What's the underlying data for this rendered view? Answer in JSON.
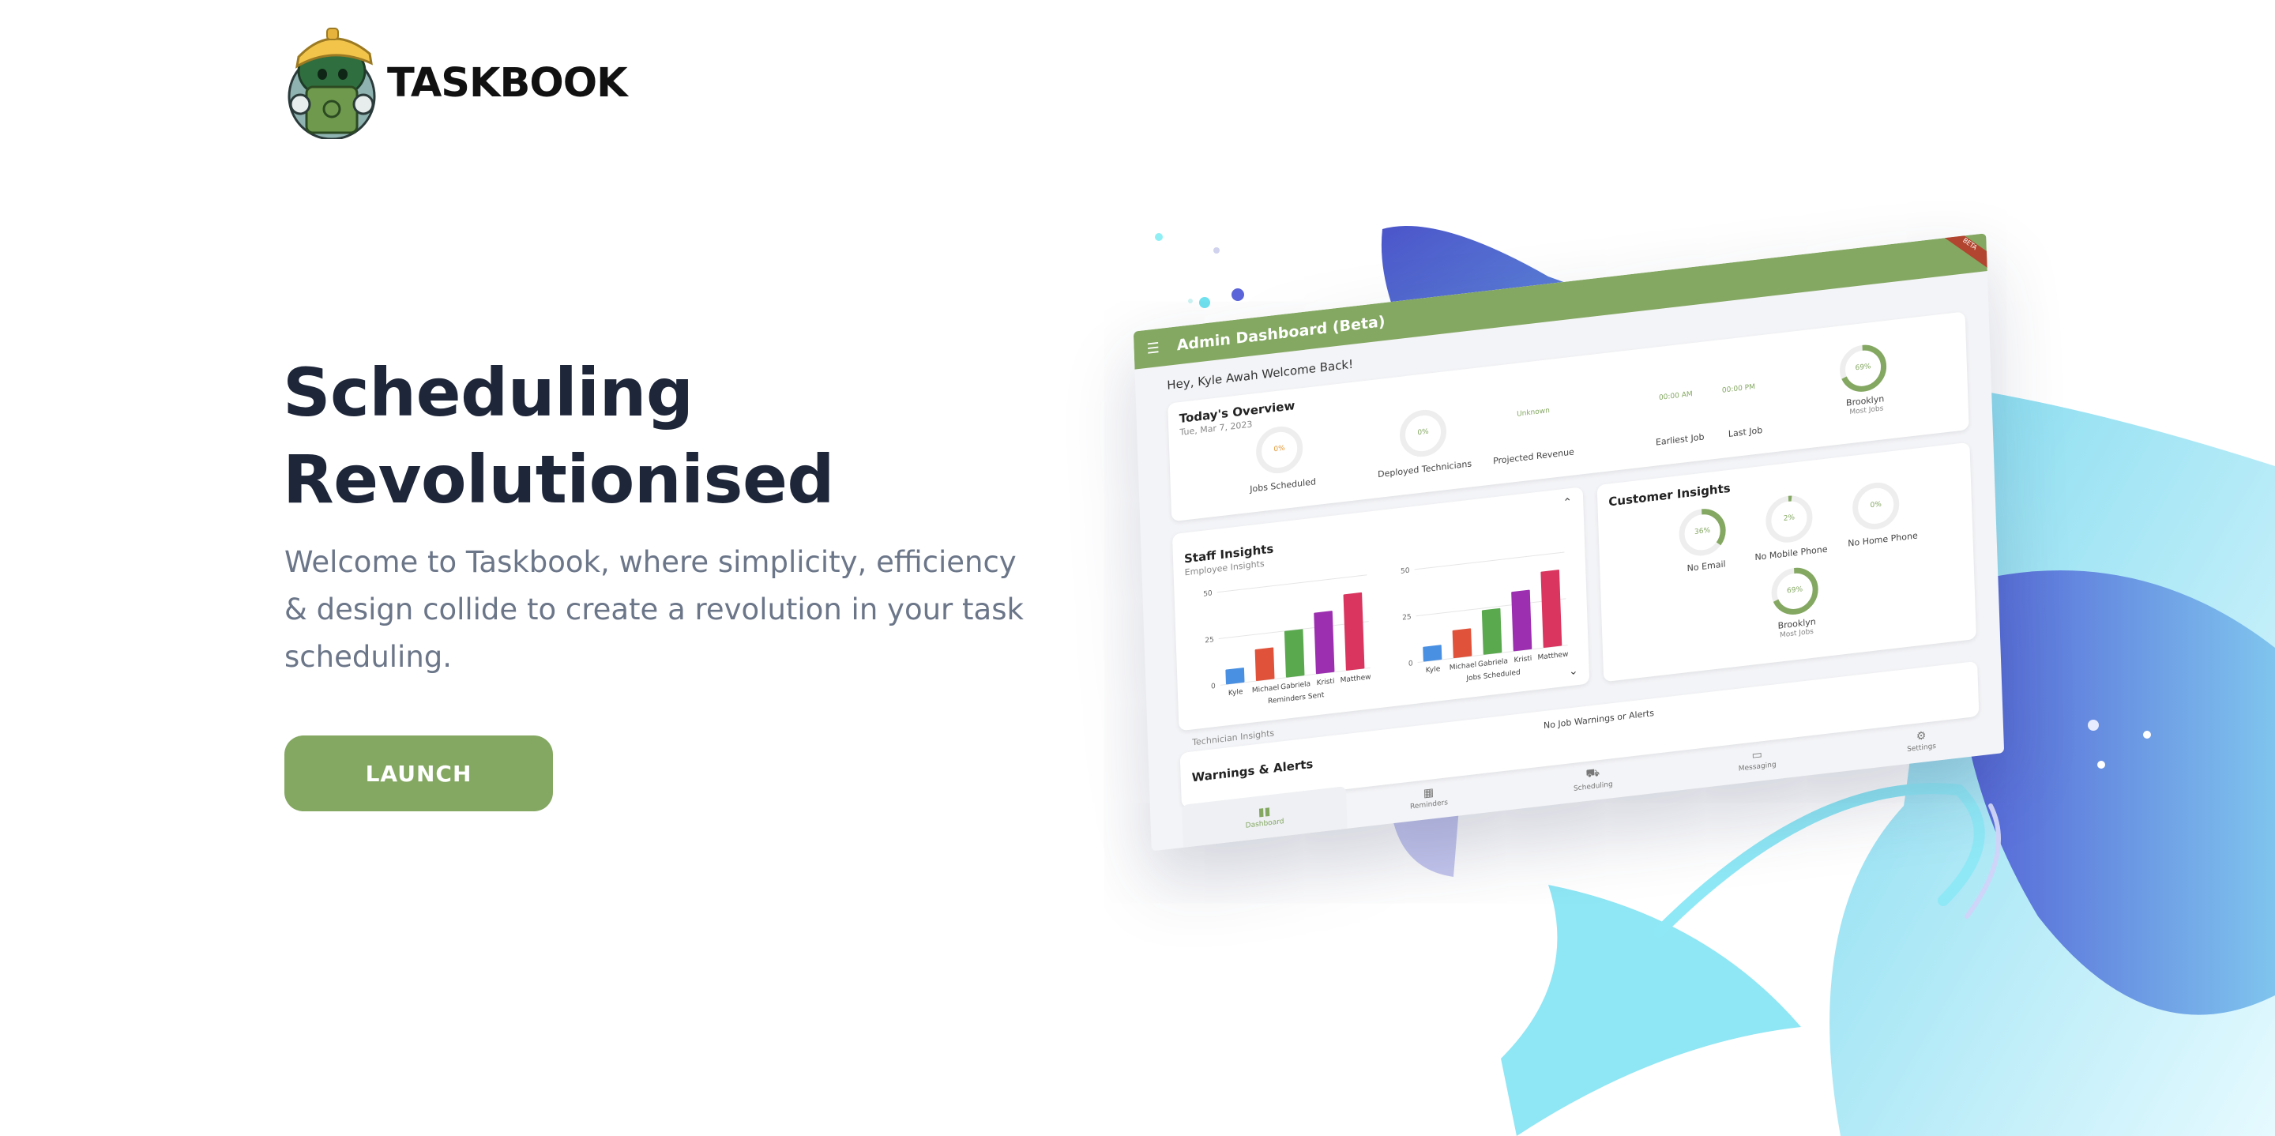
{
  "brand": {
    "name": "TASKBOOK",
    "colors": {
      "primary_green": "#84a862",
      "heading": "#1e2639",
      "body_text": "#6b7689"
    }
  },
  "hero": {
    "title_line1": "Scheduling",
    "title_line2": "Revolutionised",
    "subtitle": "Welcome to Taskbook, where simplicity, efficiency & design collide to create a revolution in your task scheduling.",
    "cta_label": "LAUNCH"
  },
  "dashboard": {
    "header_title": "Admin Dashboard (Beta)",
    "ribbon": "BETA",
    "welcome": "Hey, Kyle Awah Welcome Back!",
    "overview": {
      "title": "Today's Overview",
      "date": "Tue, Mar 7, 2023",
      "jobs_scheduled": {
        "label": "Jobs Scheduled",
        "value": "0%"
      },
      "deployed_technicians": {
        "label": "Deployed Technicians",
        "value": "0%"
      },
      "projected_revenue": {
        "label": "Projected Revenue",
        "value": "Unknown"
      },
      "earliest_job": {
        "label": "Earliest Job",
        "value": "00:00 AM"
      },
      "last_job": {
        "label": "Last Job",
        "value": "00:00 PM"
      },
      "top_location": {
        "label": "Brooklyn",
        "sub": "Most Jobs",
        "value": "69%"
      }
    },
    "staff": {
      "title": "Staff Insights",
      "subtitle": "Employee Insights",
      "technician_label": "Technician Insights"
    },
    "customers": {
      "title": "Customer Insights",
      "no_email": {
        "label": "No Email",
        "value": "36%"
      },
      "no_mobile": {
        "label": "No Mobile Phone",
        "value": "2%"
      },
      "no_home": {
        "label": "No Home Phone",
        "value": "0%"
      },
      "top_location": {
        "label": "Brooklyn",
        "sub": "Most Jobs",
        "value": "69%"
      }
    },
    "warnings": {
      "title": "Warnings & Alerts",
      "empty": "No Job Warnings or Alerts"
    },
    "nav": [
      "Dashboard",
      "Reminders",
      "Scheduling",
      "Messaging",
      "Settings"
    ]
  },
  "chart_data": [
    {
      "type": "bar",
      "categories": [
        "Kyle",
        "Michael",
        "Gabriela",
        "Kristi",
        "Matthew"
      ],
      "values": [
        8,
        17,
        25,
        33,
        41
      ],
      "xlabel": "Reminders Sent",
      "ylim": [
        0,
        50
      ],
      "yticks": [
        0,
        25,
        50
      ],
      "colors": [
        "#4a90e2",
        "#e0533a",
        "#5aa94f",
        "#9c2fb0",
        "#d9355e"
      ]
    },
    {
      "type": "bar",
      "categories": [
        "Kyle",
        "Michael",
        "Gabriela",
        "Kristi",
        "Matthew"
      ],
      "values": [
        8,
        15,
        24,
        32,
        41
      ],
      "xlabel": "Jobs Scheduled",
      "ylim": [
        0,
        50
      ],
      "yticks": [
        0,
        25,
        50
      ],
      "colors": [
        "#4a90e2",
        "#e0533a",
        "#5aa94f",
        "#9c2fb0",
        "#d9355e"
      ]
    }
  ]
}
